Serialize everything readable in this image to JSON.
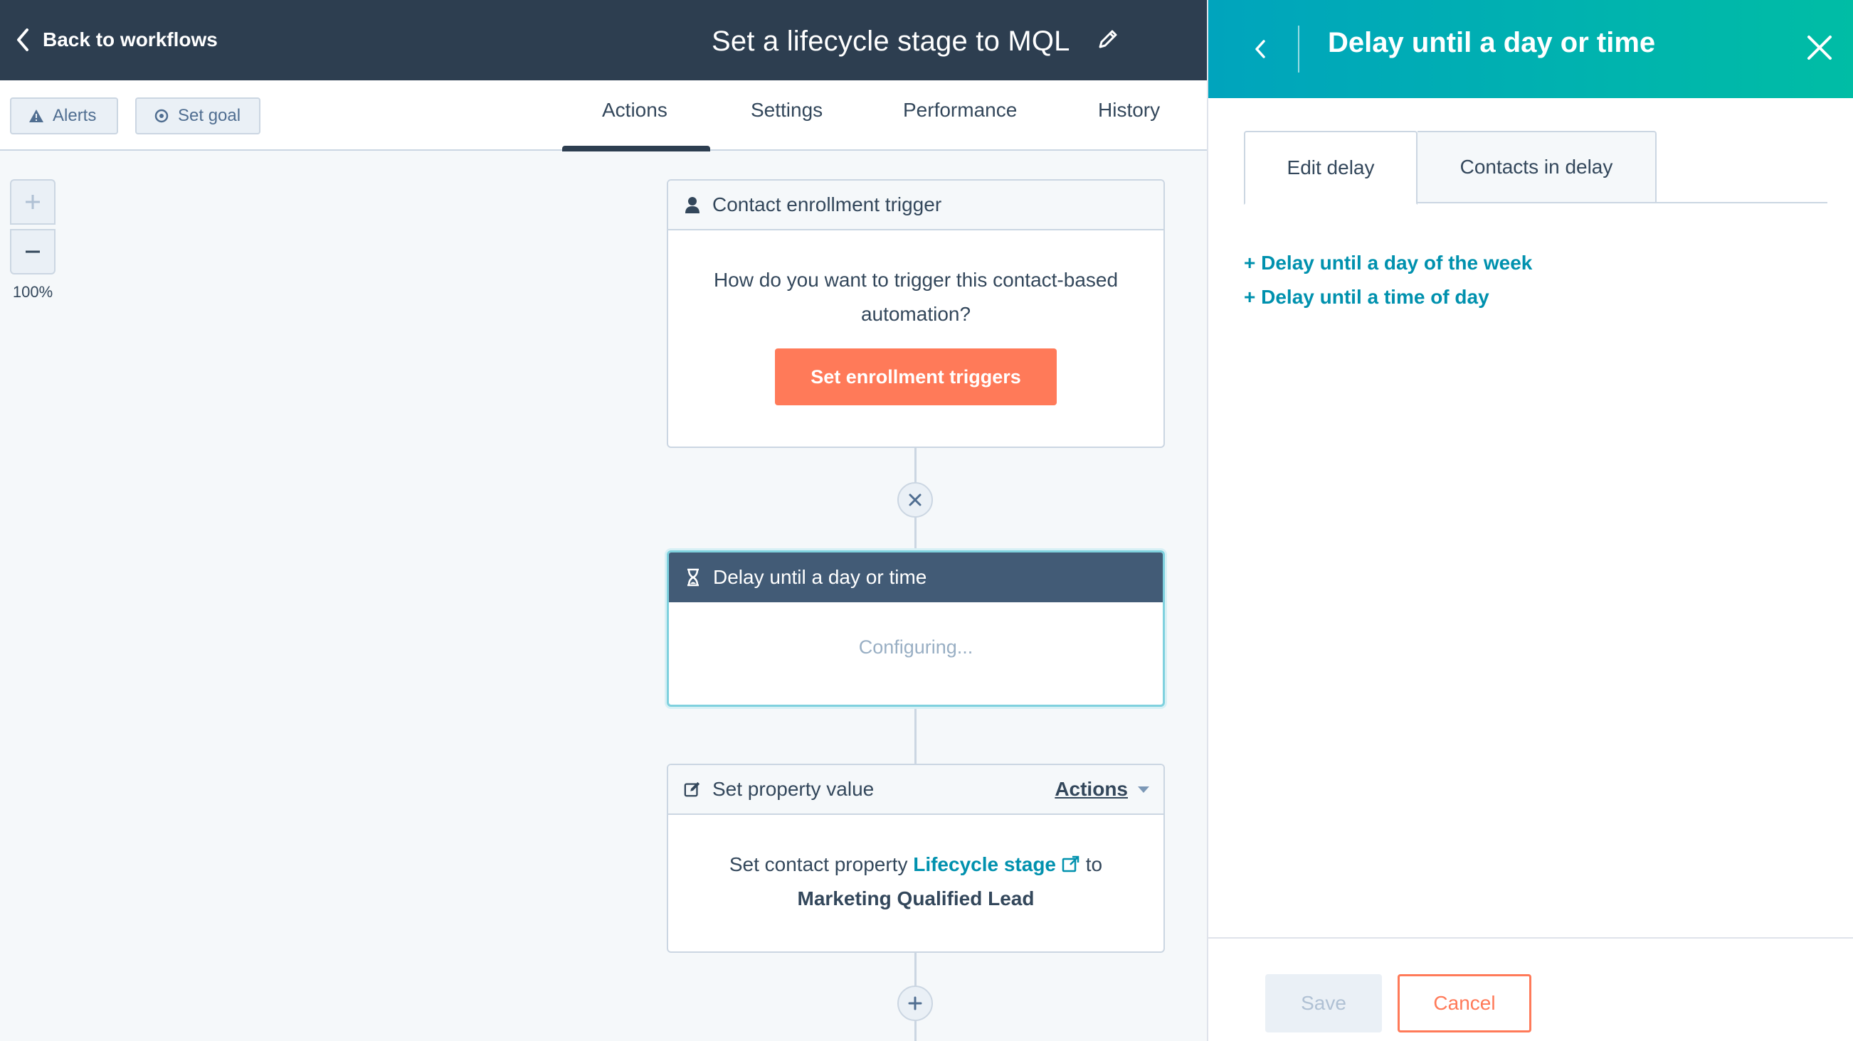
{
  "header": {
    "back_label": "Back to workflows",
    "workflow_title": "Set a lifecycle stage to MQL"
  },
  "toolbar": {
    "alerts_label": "Alerts",
    "set_goal_label": "Set goal",
    "tabs": [
      {
        "label": "Actions",
        "active": true
      },
      {
        "label": "Settings",
        "active": false
      },
      {
        "label": "Performance",
        "active": false
      },
      {
        "label": "History",
        "active": false
      }
    ]
  },
  "zoom": {
    "level": "100%"
  },
  "canvas": {
    "trigger_card": {
      "title": "Contact enrollment trigger",
      "question": "How do you want to trigger this contact-based automation?",
      "button_label": "Set enrollment triggers"
    },
    "delay_card": {
      "title": "Delay until a day or time",
      "status": "Configuring..."
    },
    "property_card": {
      "title": "Set property value",
      "actions_label": "Actions",
      "text_prefix": "Set contact property",
      "property_link": "Lifecycle stage",
      "text_to": "to",
      "value": "Marketing Qualified Lead"
    }
  },
  "panel": {
    "title": "Delay until a day or time",
    "tabs": [
      {
        "label": "Edit delay",
        "active": true
      },
      {
        "label": "Contacts in delay",
        "active": false
      }
    ],
    "options": [
      "+ Delay until a day of the week",
      "+ Delay until a time of day"
    ],
    "save_label": "Save",
    "cancel_label": "Cancel"
  },
  "colors": {
    "header_bg": "#2d3e50",
    "accent_orange": "#ff7a59",
    "accent_teal": "#0091ae",
    "panel_gradient_start": "#00a4bd",
    "panel_gradient_end": "#00bda5"
  }
}
